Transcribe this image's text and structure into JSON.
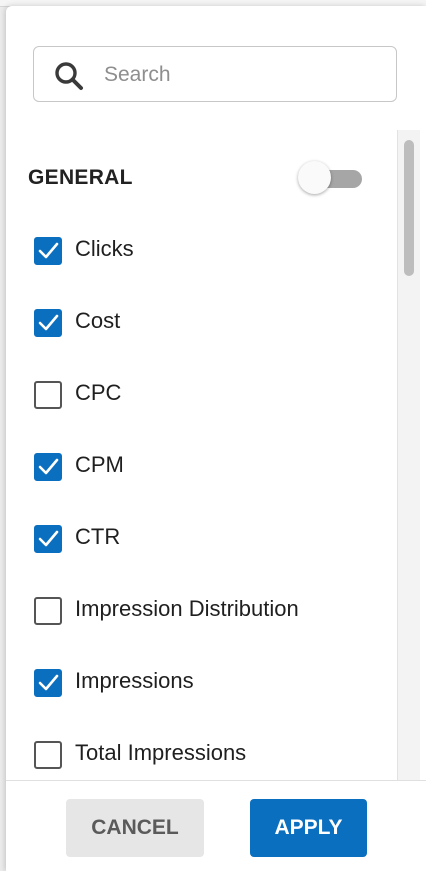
{
  "search": {
    "placeholder": "Search",
    "value": "",
    "icon": "search-icon"
  },
  "section": {
    "title": "GENERAL",
    "toggle_on": false
  },
  "items": [
    {
      "label": "Clicks",
      "checked": true
    },
    {
      "label": "Cost",
      "checked": true
    },
    {
      "label": "CPC",
      "checked": false
    },
    {
      "label": "CPM",
      "checked": true
    },
    {
      "label": "CTR",
      "checked": true
    },
    {
      "label": "Impression Distribution",
      "checked": false
    },
    {
      "label": "Impressions",
      "checked": true
    },
    {
      "label": "Total Impressions",
      "checked": false
    }
  ],
  "footer": {
    "cancel_label": "CANCEL",
    "apply_label": "APPLY"
  },
  "colors": {
    "accent": "#0b6fbf",
    "checkbox_border": "#555555",
    "toggle_track": "#a6a6a6"
  }
}
